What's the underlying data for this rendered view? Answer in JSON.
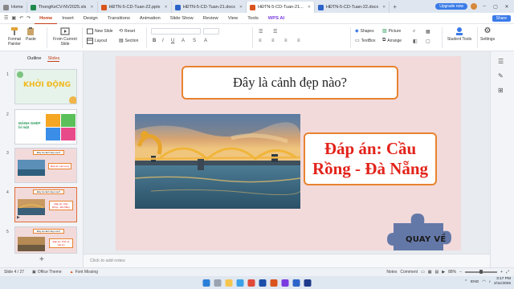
{
  "tabs": [
    {
      "label": "Home",
      "color": "#888888",
      "active": false
    },
    {
      "label": "ThongKeCV-NV2025.xls",
      "color": "#1f8a4c",
      "active": false
    },
    {
      "label": "HĐTN-5-CD-Tuan-22.pptx",
      "color": "#d9541e",
      "active": false
    },
    {
      "label": "HĐTN-5-CD-Tuan-21.docx",
      "color": "#2b63c9",
      "active": false
    },
    {
      "label": "HĐTN-5-CD-Tuan-21...",
      "color": "#d9541e",
      "active": true
    },
    {
      "label": "HĐTN-5-CD-Tuan-22.docx",
      "color": "#2b63c9",
      "active": false
    }
  ],
  "titlebar": {
    "upgrade_label": "Upgrade now"
  },
  "menu": {
    "items": [
      "Home",
      "Insert",
      "Design",
      "Transitions",
      "Animation",
      "Slide Show",
      "Review",
      "View",
      "Tools"
    ],
    "active": "Home",
    "wps_ai": "WPS AI",
    "share": "Share"
  },
  "ribbon": {
    "format_painter": "Format Painter",
    "paste": "Paste",
    "from_current_slide": "From Current Slide",
    "new_slide": "New Slide",
    "layout": "Layout",
    "reset": "Reset",
    "section": "Section",
    "shapes": "Shapes",
    "picture": "Picture",
    "textbox": "TextBox",
    "arrange": "Arrange",
    "student_tools": "Student Tools",
    "settings": "Settings"
  },
  "leftpanel": {
    "tab_outline": "Outline",
    "tab_slides": "Slides",
    "slides": [
      {
        "number": "1",
        "text": "KHỞI ĐỘNG"
      },
      {
        "number": "2",
        "text": "MẢNH GHÉP bí mật"
      },
      {
        "number": "3",
        "text": "Đây là cảnh đẹp nào?",
        "answer": "Đáp án: Hạ Long"
      },
      {
        "number": "4",
        "text": "Đây là cảnh đẹp nào?",
        "answer": "Đáp án: Cầu Rồng - Đà Nẵng"
      },
      {
        "number": "5",
        "text": "Đây là cảnh đẹp nào?",
        "answer": "Đáp án: Phố cổ Hội An"
      }
    ]
  },
  "slide": {
    "question": "Đây là cảnh đẹp nào?",
    "answer": "Đáp án: Cầu Rồng - Đà Nẵng",
    "back_button": "QUAY VỀ"
  },
  "notes_placeholder": "Click to add notes",
  "status": {
    "slide_counter": "Slide 4 / 27",
    "theme": "Office Theme",
    "font_missing": "Font Missing",
    "notes": "Notes",
    "comment": "Comment",
    "zoom": "88%"
  },
  "taskbar": {
    "lang": "ENG",
    "time": "3:17 PM",
    "date": "2/11/2025"
  }
}
